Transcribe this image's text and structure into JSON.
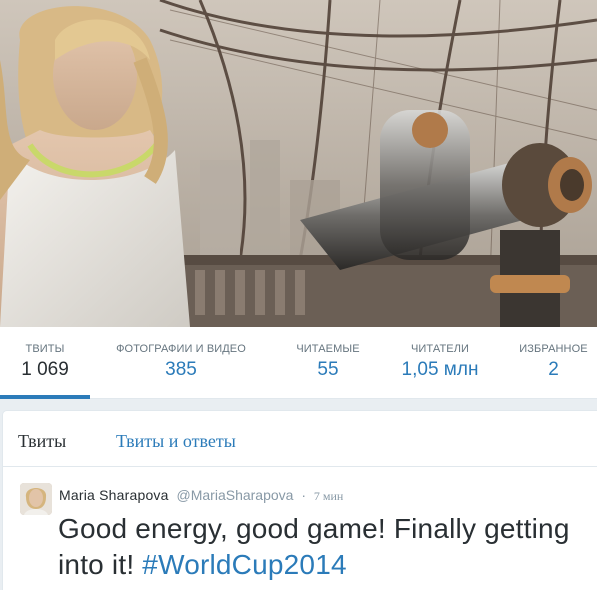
{
  "profile": {
    "header_photo": "profile-header-photo"
  },
  "stats": [
    {
      "label": "ТВИТЫ",
      "value": "1 069",
      "active": true
    },
    {
      "label": "ФОТОГРАФИИ И ВИДЕО",
      "value": "385",
      "active": false
    },
    {
      "label": "ЧИТАЕМЫЕ",
      "value": "55",
      "active": false
    },
    {
      "label": "ЧИТАТЕЛИ",
      "value": "1,05 млн",
      "active": false
    },
    {
      "label": "ИЗБРАННОЕ",
      "value": "2",
      "active": false
    }
  ],
  "timeline": {
    "tabs": [
      {
        "label": "Твиты"
      },
      {
        "label": "Твиты и ответы"
      }
    ],
    "tweet": {
      "name": "Maria Sharapova",
      "handle": "@MariaSharapova",
      "separator": "·",
      "time": "7 мин",
      "text_before": "Good energy, good game! Finally getting into it! ",
      "hashtag": "#WorldCup2014"
    }
  },
  "colors": {
    "accent": "#2b7bb9",
    "text": "#292f33",
    "muted": "#66757f",
    "border": "#e1e8ed"
  }
}
